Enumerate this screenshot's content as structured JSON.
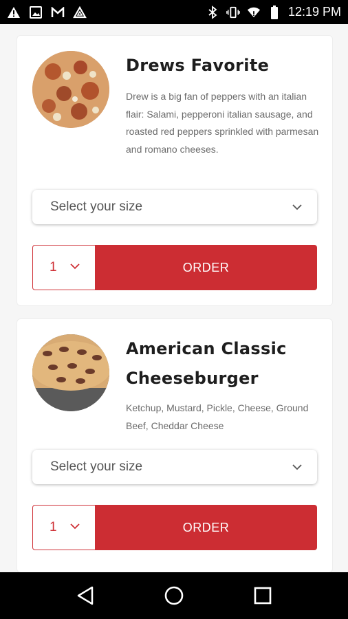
{
  "status_bar": {
    "time": "12:19 PM",
    "left_icons": [
      "warning-icon",
      "image-icon",
      "gmail-icon",
      "arlo-icon"
    ],
    "right_icons": [
      "bluetooth-icon",
      "vibrate-icon",
      "wifi-icon",
      "battery-icon"
    ]
  },
  "products": [
    {
      "title": "Drews Favorite",
      "description": "Drew is a big fan of peppers with an italian flair: Salami, pepperoni italian sausage, and roasted red peppers sprinkled with parmesan and romano cheeses.",
      "size_placeholder": "Select your size",
      "quantity": "1",
      "order_label": "ORDER"
    },
    {
      "title": "American Classic Cheeseburger",
      "description": "Ketchup, Mustard, Pickle, Cheese, Ground Beef, Cheddar Cheese",
      "size_placeholder": "Select your size",
      "quantity": "1",
      "order_label": "ORDER"
    }
  ],
  "nav_bar": {
    "buttons": [
      "back-icon",
      "home-icon",
      "recents-icon"
    ]
  },
  "colors": {
    "accent": "#cc2d33",
    "title_text": "#1e1e1e",
    "description_text": "#6b6b6b"
  }
}
